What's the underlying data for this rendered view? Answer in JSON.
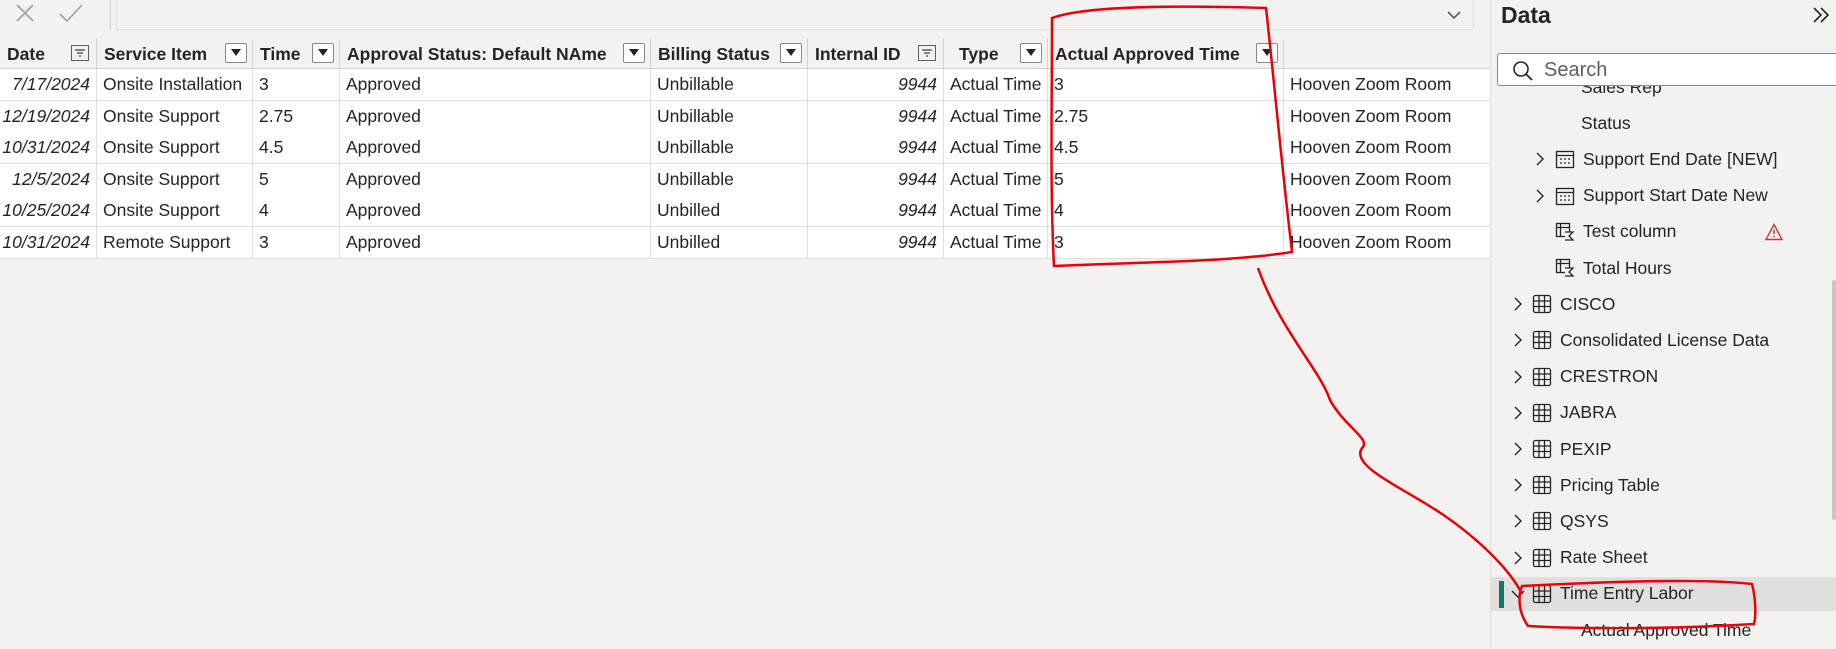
{
  "formula_bar": {
    "value": ""
  },
  "table": {
    "columns": [
      {
        "label": "Date"
      },
      {
        "label": "Service Item"
      },
      {
        "label": "Time"
      },
      {
        "label": "Approval Status: Default NAme"
      },
      {
        "label": "Billing Status"
      },
      {
        "label": "Internal ID"
      },
      {
        "label": "Type"
      },
      {
        "label": "Actual Approved Time"
      }
    ],
    "rows": [
      [
        "7/17/2024",
        "Onsite Installation",
        "3",
        "Approved",
        "Unbillable",
        "9944",
        "Actual Time",
        "3",
        "Hooven Zoom Room"
      ],
      [
        "12/19/2024",
        "Onsite Support",
        "2.75",
        "Approved",
        "Unbillable",
        "9944",
        "Actual Time",
        "2.75",
        "Hooven Zoom Room"
      ],
      [
        "10/31/2024",
        "Onsite Support",
        "4.5",
        "Approved",
        "Unbillable",
        "9944",
        "Actual Time",
        "4.5",
        "Hooven Zoom Room"
      ],
      [
        "12/5/2024",
        "Onsite Support",
        "5",
        "Approved",
        "Unbillable",
        "9944",
        "Actual Time",
        "5",
        "Hooven Zoom Room"
      ],
      [
        "10/25/2024",
        "Onsite Support",
        "4",
        "Approved",
        "Unbilled",
        "9944",
        "Actual Time",
        "4",
        "Hooven Zoom Room"
      ],
      [
        "10/31/2024",
        "Remote Support",
        "3",
        "Approved",
        "Unbilled",
        "9944",
        "Actual Time",
        "3",
        "Hooven Zoom Room"
      ]
    ]
  },
  "data_pane": {
    "title": "Data",
    "search_placeholder": "Search",
    "items": [
      {
        "label": "Sales Rep",
        "kind": "field"
      },
      {
        "label": "Status",
        "kind": "field"
      },
      {
        "label": "Support End Date [NEW]",
        "kind": "date"
      },
      {
        "label": "Support Start Date New",
        "kind": "date"
      },
      {
        "label": "Test column",
        "kind": "measure",
        "warning": true
      },
      {
        "label": "Total Hours",
        "kind": "measure"
      },
      {
        "label": "CISCO",
        "kind": "table"
      },
      {
        "label": "Consolidated License Data",
        "kind": "table"
      },
      {
        "label": "CRESTRON",
        "kind": "table"
      },
      {
        "label": "JABRA",
        "kind": "table"
      },
      {
        "label": "PEXIP",
        "kind": "table"
      },
      {
        "label": "Pricing Table",
        "kind": "table"
      },
      {
        "label": "QSYS",
        "kind": "table"
      },
      {
        "label": "Rate Sheet",
        "kind": "table"
      },
      {
        "label": "Time Entry Labor",
        "kind": "table",
        "expanded": true,
        "selected": true
      },
      {
        "label": "Actual Approved Time",
        "kind": "field"
      }
    ]
  },
  "colors": {
    "accent": "#117865",
    "annotation": "#e8000b",
    "warning": "#d13438"
  }
}
